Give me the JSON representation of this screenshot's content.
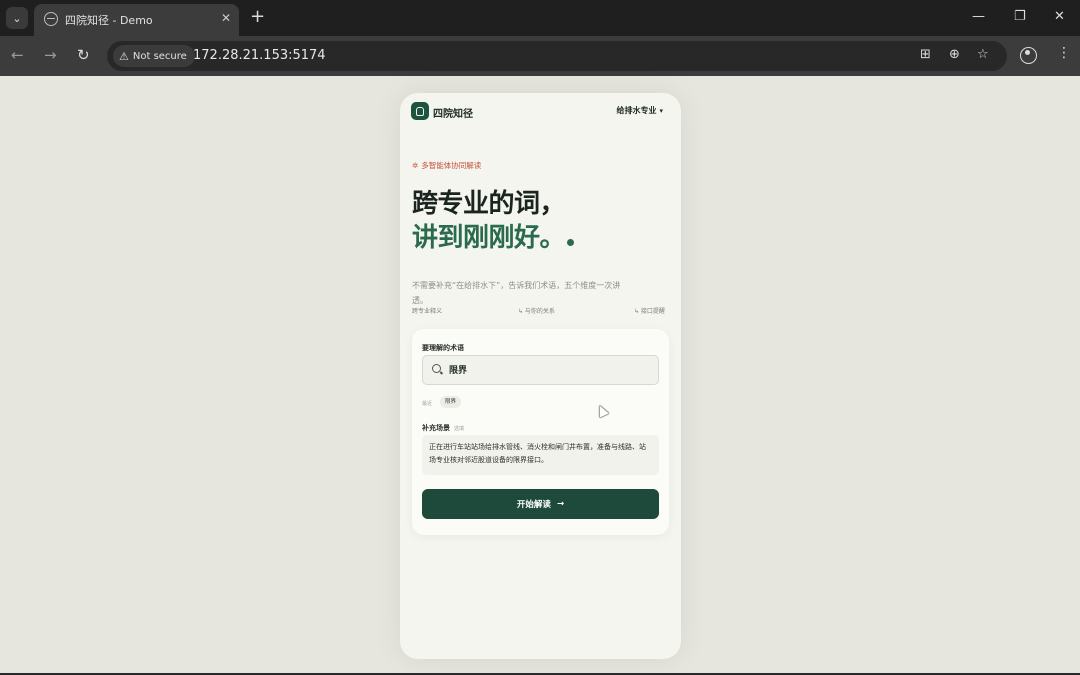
{
  "browser": {
    "tab_title": "四院知径 - Demo",
    "security_label": "Not secure",
    "url": "172.28.21.153:5174",
    "icons": [
      "tab-list-icon",
      "globe-icon",
      "close-icon",
      "plus-icon",
      "minimize-icon",
      "restore-icon",
      "back-icon",
      "forward-icon",
      "reload-icon",
      "warning-icon",
      "translate-icon",
      "zoom-icon",
      "star-icon",
      "profile-icon",
      "more-icon"
    ]
  },
  "app": {
    "brand": "四院知径",
    "major": "给排水专业",
    "kicker": "多智能体协同解读",
    "hero_line1": "跨专业的词，",
    "hero_line2": "讲到刚刚好。",
    "subtitle": "不需要补充“在给排水下”，告诉我们术语，五个维度一次讲透。",
    "features": [
      "跨专业释义",
      "↳ 与你的关系",
      "↳ 接口提醒"
    ],
    "colors": {
      "accent": "#1d4a3a",
      "accent_text": "#2a6b4e",
      "kicker": "#c8503a",
      "background": "#e6e6df"
    }
  },
  "form": {
    "term_label": "要理解的术语",
    "search_value": "限界",
    "history_label": "最近",
    "history_chip": "限界",
    "context_label": "补充场景",
    "context_optional": "选填",
    "context_text": "正在进行车站站场给排水管线、消火栓和闸门井布置，准备与线路、站场专业核对邻近股道设备的限界接口。",
    "submit_label": "开始解读",
    "submit_icon": "→"
  }
}
